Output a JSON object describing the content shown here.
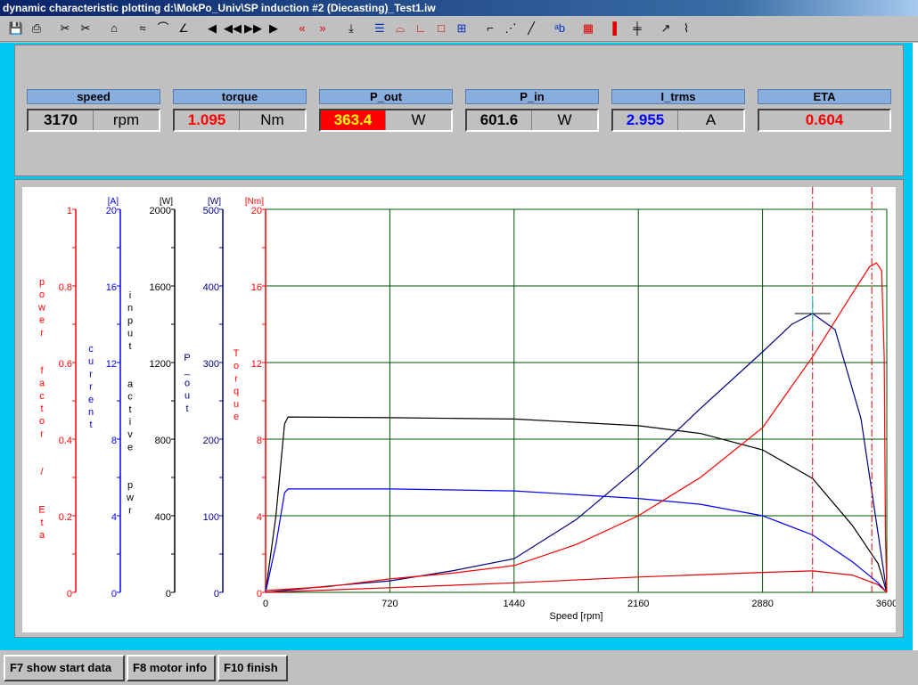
{
  "window": {
    "title": "dynamic characteristic plotting  d:\\MokPo_Univ\\SP induction #2 (Diecasting)_Test1.iw"
  },
  "toolbar": {
    "icons": [
      "save-icon",
      "print-icon",
      "cut-left-icon",
      "cut-right-icon",
      "clear-icon",
      "curve-a-icon",
      "curve-b-icon",
      "curve-c-icon",
      "first-icon",
      "prev-icon",
      "next-icon",
      "last-icon",
      "marker-left-icon",
      "marker-right-icon",
      "cursor-icon",
      "legend-icon",
      "scale-icon",
      "axis-l-icon",
      "axis-box-icon",
      "grid-icon",
      "line-icon",
      "dots-icon",
      "diagonal-icon",
      "label-abc-icon",
      "bitmap-icon",
      "red-bar-icon",
      "double-bar-icon",
      "load-icon",
      "multi-curve-icon"
    ]
  },
  "meters": [
    {
      "label": "speed",
      "value": "3170",
      "unit": "rpm",
      "color": "#000000",
      "bg": "#c0c0c0"
    },
    {
      "label": "torque",
      "value": "1.095",
      "unit": "Nm",
      "color": "#ff0000",
      "bg": "#c0c0c0"
    },
    {
      "label": "P_out",
      "value": "363.4",
      "unit": "W",
      "color": "#ffff00",
      "bg": "#ff0000"
    },
    {
      "label": "P_in",
      "value": "601.6",
      "unit": "W",
      "color": "#000000",
      "bg": "#c0c0c0"
    },
    {
      "label": "I_trms",
      "value": "2.955",
      "unit": "A",
      "color": "#0000ff",
      "bg": "#c0c0c0"
    },
    {
      "label": "ETA",
      "value": "0.604",
      "unit": "",
      "color": "#ff0000",
      "bg": "#c0c0c0"
    }
  ],
  "chart_data": {
    "type": "line",
    "xlabel": "Speed [rpm]",
    "xlim": [
      0,
      3600
    ],
    "xticks": [
      "0",
      "720",
      "1440",
      "2160",
      "2880",
      "3600"
    ],
    "grid": true,
    "axes": [
      {
        "label": "power  factor  /  Eta",
        "unit": "",
        "ticks": [
          "0",
          "0.2",
          "0.4",
          "0.6",
          "0.8",
          "1"
        ],
        "range": [
          0,
          1
        ],
        "color": "#ff0000"
      },
      {
        "label": "current",
        "unit": "[A]",
        "ticks": [
          "0",
          "4",
          "8",
          "12",
          "16",
          "20"
        ],
        "range": [
          0,
          20
        ],
        "color": "#0000ff"
      },
      {
        "label": "input  active  pwr",
        "unit": "[W]",
        "ticks": [
          "0",
          "400",
          "800",
          "1200",
          "1600",
          "2000"
        ],
        "range": [
          0,
          2000
        ],
        "color": "#000000"
      },
      {
        "label": "P_out",
        "unit": "[W]",
        "ticks": [
          "0",
          "100",
          "200",
          "300",
          "400",
          "500"
        ],
        "range": [
          0,
          500
        ],
        "color": "#000080"
      },
      {
        "label": "Torque",
        "unit": "[Nm]",
        "ticks": [
          "0",
          "4",
          "8",
          "12",
          "16",
          "20"
        ],
        "range": [
          0,
          20
        ],
        "color": "#ff0000"
      }
    ],
    "series": [
      {
        "axis": 2,
        "color": "#000000",
        "x": [
          0,
          60,
          110,
          130,
          720,
          1440,
          2160,
          2520,
          2880,
          3170,
          3400,
          3550,
          3600
        ],
        "y": [
          0,
          400,
          880,
          916,
          912,
          905,
          870,
          830,
          744,
          595,
          350,
          150,
          0
        ]
      },
      {
        "axis": 1,
        "color": "#0000ff",
        "x": [
          0,
          60,
          110,
          130,
          720,
          1440,
          2160,
          2520,
          2880,
          3170,
          3400,
          3550,
          3600
        ],
        "y": [
          0,
          2.5,
          5.2,
          5.4,
          5.4,
          5.3,
          4.9,
          4.6,
          4.0,
          3.0,
          1.6,
          0.5,
          0
        ]
      },
      {
        "axis": 3,
        "color": "#000080",
        "x": [
          0,
          360,
          720,
          1080,
          1440,
          1800,
          2160,
          2520,
          2880,
          3050,
          3170,
          3300,
          3450,
          3550,
          3600
        ],
        "y": [
          0,
          8,
          15,
          28,
          44,
          95,
          163,
          240,
          314,
          350,
          364,
          343,
          227,
          76,
          0
        ]
      },
      {
        "axis": 4,
        "color": "#ff0000",
        "x": [
          0,
          360,
          720,
          1080,
          1440,
          1800,
          2160,
          2520,
          2880,
          3170,
          3400,
          3500,
          3540,
          3570,
          3585,
          3592,
          3600
        ],
        "y": [
          0.1,
          0.3,
          0.7,
          1.0,
          1.4,
          2.5,
          4.0,
          6.0,
          8.6,
          12.3,
          15.6,
          17.0,
          17.2,
          16.8,
          12.3,
          3,
          0
        ]
      },
      {
        "axis": 0,
        "color": "#dd0000",
        "x": [
          0,
          720,
          1440,
          2160,
          2880,
          3170,
          3400,
          3550,
          3600
        ],
        "y": [
          0,
          0.012,
          0.025,
          0.04,
          0.052,
          0.056,
          0.045,
          0.02,
          0
        ]
      }
    ],
    "markers": [
      3170,
      3513
    ]
  },
  "buttons": {
    "f7": "F7 show start data",
    "f8": "F8 motor info",
    "f10": "F10 finish"
  }
}
